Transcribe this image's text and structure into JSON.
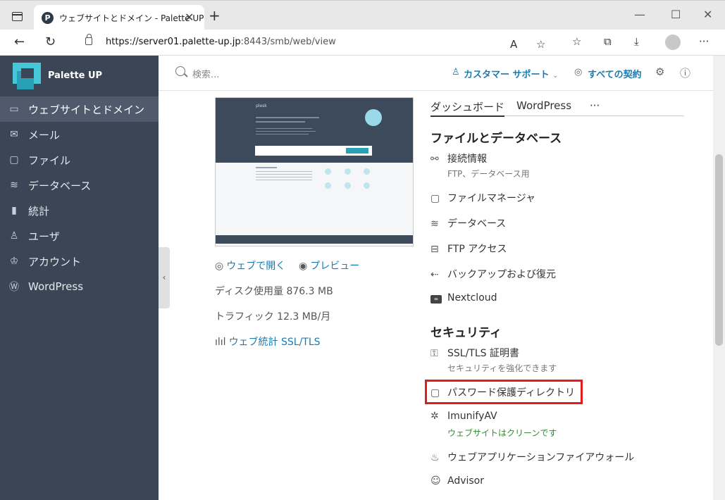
{
  "browser": {
    "tab_title": "ウェブサイトとドメイン - Palette UP",
    "tab_favicon": "P",
    "url_host": "https://server01.palette-up.jp",
    "url_rest": ":8443/smb/web/view"
  },
  "sidebar": {
    "brand": "Palette UP",
    "items": [
      {
        "label": "ウェブサイトとドメイン",
        "icon": "monitor-icon"
      },
      {
        "label": "メール",
        "icon": "mail-icon"
      },
      {
        "label": "ファイル",
        "icon": "folder-icon"
      },
      {
        "label": "データベース",
        "icon": "database-icon"
      },
      {
        "label": "統計",
        "icon": "chart-icon"
      },
      {
        "label": "ユーザ",
        "icon": "user-icon"
      },
      {
        "label": "アカウント",
        "icon": "account-icon"
      },
      {
        "label": "WordPress",
        "icon": "wordpress-icon"
      }
    ]
  },
  "header": {
    "search_placeholder": "検索...",
    "customer_support": "カスタマー サポート",
    "all_subscriptions": "すべての契約"
  },
  "site": {
    "open_web": "ウェブで開く",
    "preview": "プレビュー",
    "disk_usage": "ディスク使用量 876.3 MB",
    "traffic": "トラフィック 12.3 MB/月",
    "web_stats": "ウェブ統計 SSL/TLS"
  },
  "preview_image": {
    "brand": "plesk"
  },
  "tabs": [
    "ダッシュボード",
    "WordPress",
    "···"
  ],
  "files_section": {
    "title": "ファイルとデータベース",
    "items": [
      {
        "label": "接続情報",
        "sub": "FTP、データベース用"
      },
      {
        "label": "ファイルマネージャ"
      },
      {
        "label": "データベース"
      },
      {
        "label": "FTP アクセス"
      },
      {
        "label": "バックアップおよび復元"
      },
      {
        "label": "Nextcloud"
      }
    ]
  },
  "security_section": {
    "title": "セキュリティ",
    "items": [
      {
        "label": "SSL/TLS 証明書",
        "sub": "セキュリティを強化できます"
      },
      {
        "label": "パスワード保護ディレクトリ"
      },
      {
        "label": "ImunifyAV",
        "sub": "ウェブサイトはクリーンです"
      },
      {
        "label": "ウェブアプリケーションファイアウォール"
      },
      {
        "label": "Advisor"
      }
    ]
  },
  "colors": {
    "sidebar_bg": "#3a4555",
    "link": "#1a7bb0",
    "highlight": "#e01c1c",
    "status_ok": "#2e8b2e"
  }
}
